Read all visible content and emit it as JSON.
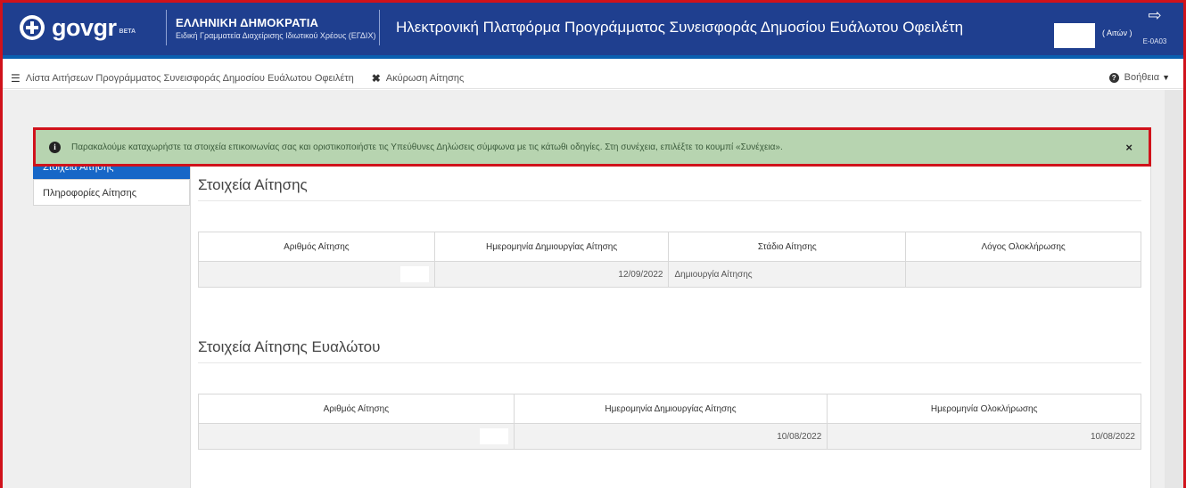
{
  "header": {
    "logo_text": "govgr",
    "logo_badge": "BETA",
    "org_title": "ΕΛΛΗΝΙΚΗ ΔΗΜΟΚΡΑΤΙΑ",
    "org_subtitle": "Ειδική Γραμματεία Διαχείρισης Ιδιωτικού Χρέους (ΕΓΔΙΧ)",
    "platform_title": "Ηλεκτρονική Πλατφόρμα Προγράμματος Συνεισφοράς Δημοσίου Ευάλωτου Οφειλέτη",
    "user_role": "( Αιτών )",
    "logout_code": "E-0A03",
    "colors": {
      "header_bg": "#1f3f8f",
      "accent": "#1767c7",
      "alert_bg": "#b7d4b0",
      "frame": "#d0121b"
    }
  },
  "breadcrumb": {
    "list_label": "Λίστα Αιτήσεων Προγράμματος Συνεισφοράς Δημοσίου Ευάλωτου Οφειλέτη",
    "cancel_label": "Ακύρωση Αίτησης",
    "help_label": "Βοήθεια"
  },
  "alert": {
    "message": "Παρακαλούμε καταχωρήστε τα στοιχεία επικοινωνίας σας και οριστικοποιήστε τις Υπεύθυνες Δηλώσεις σύμφωνα με τις κάτωθι οδηγίες. Στη συνέχεια, επιλέξτε το κουμπί «Συνέχεια».",
    "close": "×"
  },
  "sidebar": {
    "items": [
      {
        "label": "Στοιχεία Αίτησης",
        "active": true
      },
      {
        "label": "Πληροφορίες Αίτησης",
        "active": false
      }
    ]
  },
  "section1": {
    "title": "Στοιχεία Αίτησης",
    "columns": [
      "Αριθμός Αίτησης",
      "Ημερομηνία Δημιουργίας Αίτησης",
      "Στάδιο Αίτησης",
      "Λόγος Ολοκλήρωσης"
    ],
    "row": {
      "date": "12/09/2022",
      "stage": "Δημιουργία Αίτησης"
    }
  },
  "section2": {
    "title": "Στοιχεία Αίτησης Ευαλώτου",
    "columns": [
      "Αριθμός Αίτησης",
      "Ημερομηνία Δημιουργίας Αίτησης",
      "Ημερομηνία Ολοκλήρωσης"
    ],
    "row": {
      "created": "10/08/2022",
      "completed": "10/08/2022"
    }
  }
}
